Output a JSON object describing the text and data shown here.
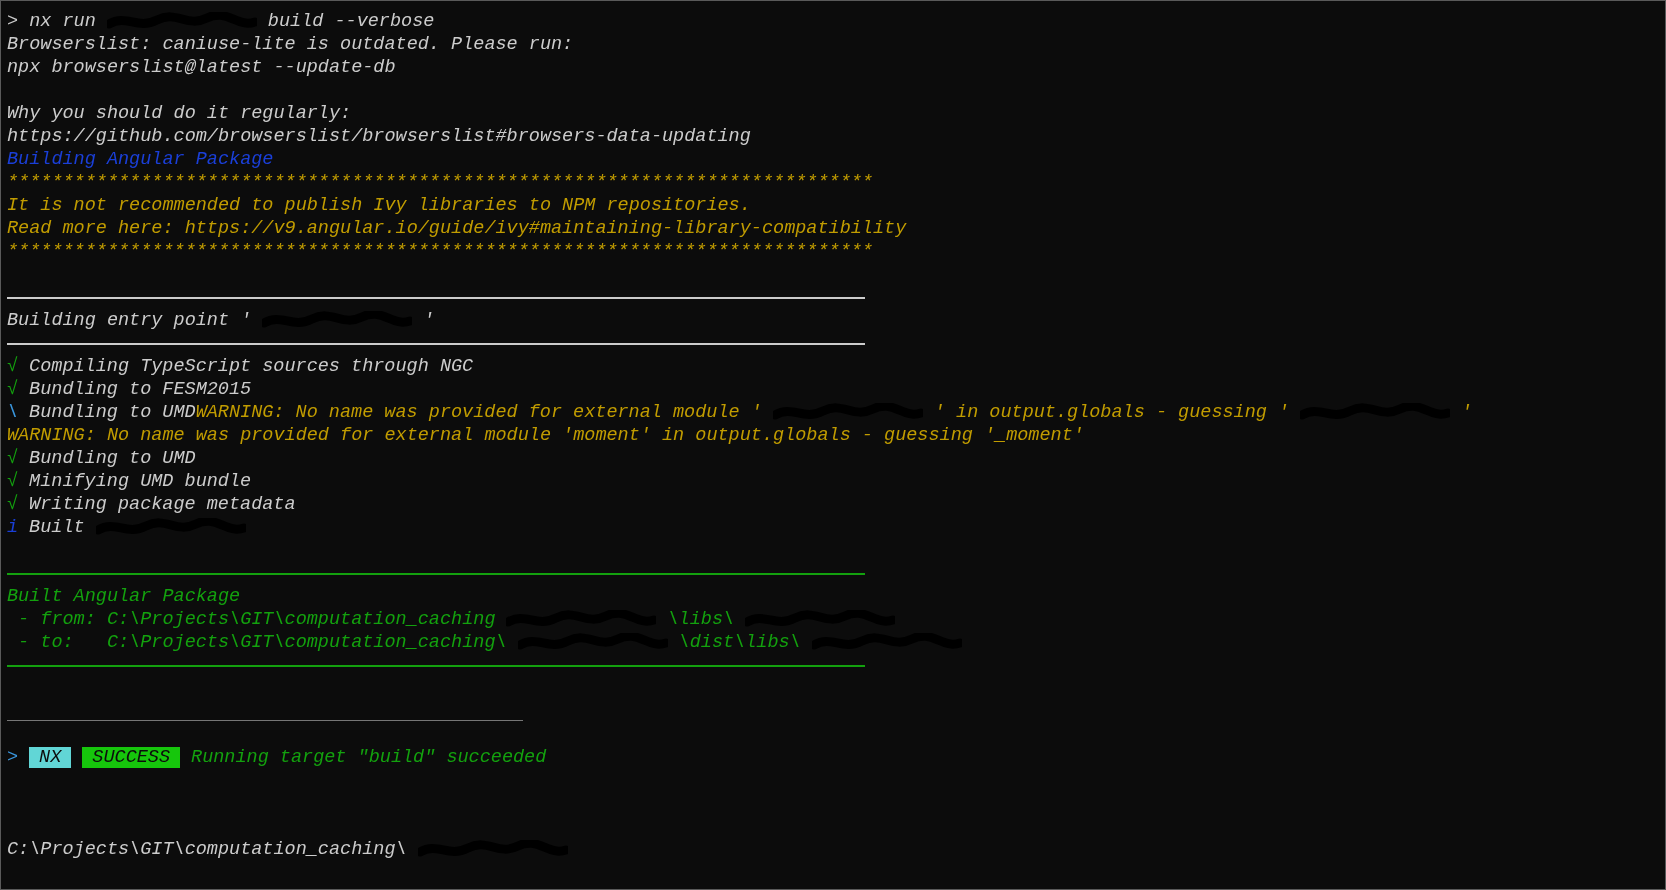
{
  "terminal": {
    "lines": [
      {
        "kind": "text",
        "segments": [
          {
            "kind": "text",
            "text": "> nx run",
            "color": "#cccccc"
          },
          {
            "kind": "redacted"
          },
          {
            "kind": "text",
            "text": "build --verbose",
            "color": "#cccccc"
          }
        ]
      },
      {
        "kind": "text",
        "segments": [
          {
            "kind": "text",
            "text": "Browserslist: caniuse-lite is outdated. Please run:",
            "color": "#cccccc"
          }
        ]
      },
      {
        "kind": "text",
        "segments": [
          {
            "kind": "text",
            "text": "npx browserslist@latest --update-db",
            "color": "#cccccc"
          }
        ]
      },
      {
        "kind": "blank"
      },
      {
        "kind": "text",
        "segments": [
          {
            "kind": "text",
            "text": "Why you should do it regularly:",
            "color": "#cccccc"
          }
        ]
      },
      {
        "kind": "text",
        "segments": [
          {
            "kind": "text",
            "text": "https://github.com/browserslist/browserslist#browsers-data-updating",
            "color": "#cccccc"
          }
        ]
      },
      {
        "kind": "text",
        "segments": [
          {
            "kind": "text",
            "text": "Building Angular Package",
            "color": "#1a3fd8"
          }
        ]
      },
      {
        "kind": "text",
        "segments": [
          {
            "kind": "text",
            "text": "******************************************************************************",
            "color": "#c19c00"
          }
        ]
      },
      {
        "kind": "text",
        "segments": [
          {
            "kind": "text",
            "text": "It is not recommended to publish Ivy libraries to NPM repositories.",
            "color": "#c19c00"
          }
        ]
      },
      {
        "kind": "text",
        "segments": [
          {
            "kind": "text",
            "text": "Read more here: https://v9.angular.io/guide/ivy#maintaining-library-compatibility",
            "color": "#c19c00"
          }
        ]
      },
      {
        "kind": "text",
        "segments": [
          {
            "kind": "text",
            "text": "******************************************************************************",
            "color": "#c19c00"
          }
        ]
      },
      {
        "kind": "blank"
      },
      {
        "kind": "rule",
        "color": "#cccccc"
      },
      {
        "kind": "text",
        "segments": [
          {
            "kind": "text",
            "text": "Building entry point '",
            "color": "#cccccc"
          },
          {
            "kind": "redacted"
          },
          {
            "kind": "text",
            "text": "'",
            "color": "#cccccc"
          }
        ]
      },
      {
        "kind": "rule",
        "color": "#cccccc"
      },
      {
        "kind": "text",
        "segments": [
          {
            "kind": "text",
            "text": "√",
            "color": "#13a10e"
          },
          {
            "kind": "text",
            "text": "Compiling TypeScript sources through NGC",
            "color": "#cccccc"
          }
        ]
      },
      {
        "kind": "text",
        "segments": [
          {
            "kind": "text",
            "text": "√",
            "color": "#13a10e"
          },
          {
            "kind": "text",
            "text": "Bundling to FESM2015",
            "color": "#cccccc"
          }
        ]
      },
      {
        "kind": "text",
        "segments": [
          {
            "kind": "text",
            "text": "\\",
            "color": "#3a96dd"
          },
          {
            "kind": "text",
            "text": "Bundling to UMD",
            "color": "#cccccc"
          },
          {
            "kind": "text",
            "text": "WARNING: No name was provided for external module '",
            "color": "#c19c00",
            "join": true
          },
          {
            "kind": "redacted"
          },
          {
            "kind": "text",
            "text": "' in output.globals - guessing '",
            "color": "#c19c00"
          },
          {
            "kind": "redacted"
          },
          {
            "kind": "text",
            "text": "'",
            "color": "#c19c00"
          }
        ]
      },
      {
        "kind": "text",
        "segments": [
          {
            "kind": "text",
            "text": "WARNING: No name was provided for external module 'moment' in output.globals - guessing '_moment'",
            "color": "#c19c00"
          }
        ]
      },
      {
        "kind": "text",
        "segments": [
          {
            "kind": "text",
            "text": "√",
            "color": "#13a10e"
          },
          {
            "kind": "text",
            "text": "Bundling to UMD",
            "color": "#cccccc"
          }
        ]
      },
      {
        "kind": "text",
        "segments": [
          {
            "kind": "text",
            "text": "√",
            "color": "#13a10e"
          },
          {
            "kind": "text",
            "text": "Minifying UMD bundle",
            "color": "#cccccc"
          }
        ]
      },
      {
        "kind": "text",
        "segments": [
          {
            "kind": "text",
            "text": "√",
            "color": "#13a10e"
          },
          {
            "kind": "text",
            "text": "Writing package metadata",
            "color": "#cccccc"
          }
        ]
      },
      {
        "kind": "text",
        "segments": [
          {
            "kind": "text",
            "text": "i",
            "color": "#1a3fd8"
          },
          {
            "kind": "text",
            "text": "Built",
            "color": "#cccccc"
          },
          {
            "kind": "redacted"
          }
        ]
      },
      {
        "kind": "blank"
      },
      {
        "kind": "rule",
        "color": "#13a10e"
      },
      {
        "kind": "text",
        "segments": [
          {
            "kind": "text",
            "text": "Built Angular Package",
            "color": "#13a10e"
          }
        ]
      },
      {
        "kind": "text",
        "segments": [
          {
            "kind": "text",
            "text": " - from: C:\\Projects\\GIT\\computation_caching",
            "color": "#13a10e"
          },
          {
            "kind": "redacted"
          },
          {
            "kind": "text",
            "text": "\\libs\\",
            "color": "#13a10e"
          },
          {
            "kind": "redacted"
          }
        ]
      },
      {
        "kind": "text",
        "segments": [
          {
            "kind": "text",
            "text": " - to:   C:\\Projects\\GIT\\computation_caching\\",
            "color": "#13a10e"
          },
          {
            "kind": "redacted"
          },
          {
            "kind": "text",
            "text": "\\dist\\libs\\",
            "color": "#13a10e"
          },
          {
            "kind": "redacted"
          }
        ]
      },
      {
        "kind": "rule",
        "color": "#13a10e"
      },
      {
        "kind": "blank"
      },
      {
        "kind": "short_rule",
        "color": "#767676"
      },
      {
        "kind": "blank"
      },
      {
        "kind": "text",
        "segments": [
          {
            "kind": "text",
            "text": ">",
            "color": "#3a96dd"
          },
          {
            "kind": "badge",
            "text": "NX",
            "color": "#61d6d6"
          },
          {
            "kind": "badge",
            "text": "SUCCESS",
            "color": "#16c60c"
          },
          {
            "kind": "text",
            "text": "Running target \"build\" succeeded",
            "color": "#13a10e"
          }
        ]
      },
      {
        "kind": "blank"
      },
      {
        "kind": "blank"
      },
      {
        "kind": "blank"
      },
      {
        "kind": "text",
        "segments": [
          {
            "kind": "text",
            "text": "C:\\Projects\\GIT\\computation_caching\\",
            "color": "#cccccc"
          },
          {
            "kind": "redacted"
          }
        ]
      }
    ]
  }
}
